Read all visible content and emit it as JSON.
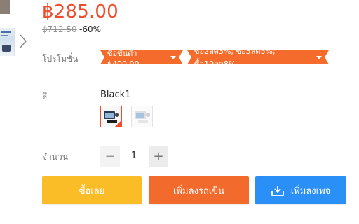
{
  "product": {
    "price": "฿285.00",
    "original_price": "฿712.50",
    "discount": "-60%"
  },
  "promotion": {
    "label": "โปรโมชั่น",
    "tags": [
      "ซื้อขั้นต่ำ ฿400.00",
      "ซื้อ2ลด3%; ซื้อ5ลด5%; ซื้อ10ลด8%"
    ]
  },
  "color": {
    "label": "สี",
    "selected": "Black1",
    "options": [
      "Black1",
      "White"
    ]
  },
  "quantity": {
    "label": "จำนวน",
    "value": "1",
    "minus": "−",
    "plus": "+"
  },
  "actions": {
    "buy_now": "ซื้อเลย",
    "add_to_cart": "เพิ่มลงรถเข็น",
    "add_to_page": "เพิ่มลงเพจ"
  },
  "colors": {
    "accent": "#ee4d2d",
    "promo": "#f46b2c",
    "buy": "#fbbd27",
    "cart": "#f26b2c",
    "page": "#2a8ff7"
  }
}
